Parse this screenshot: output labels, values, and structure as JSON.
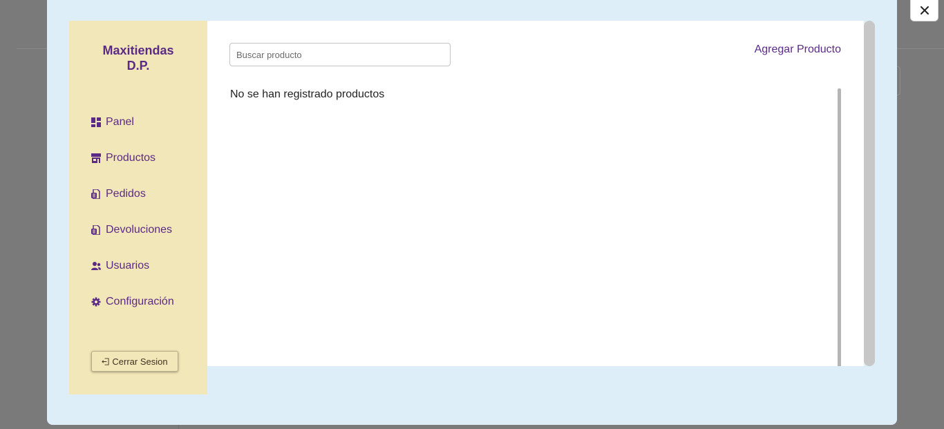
{
  "sidebar": {
    "brand_line1": "Maxitiendas",
    "brand_line2": "D.P.",
    "items": [
      {
        "label": "Panel",
        "icon": "dashboard-icon"
      },
      {
        "label": "Productos",
        "icon": "store-icon"
      },
      {
        "label": "Pedidos",
        "icon": "file-invoice-icon"
      },
      {
        "label": "Devoluciones",
        "icon": "file-invoice-icon"
      },
      {
        "label": "Usuarios",
        "icon": "users-icon"
      },
      {
        "label": "Configuración",
        "icon": "gear-icon"
      }
    ],
    "logout_label": "Cerrar Sesion"
  },
  "main": {
    "search_placeholder": "Buscar producto",
    "add_label": "Agregar Producto",
    "empty_message": "No se han registrado productos"
  },
  "colors": {
    "accent": "#5b2a86",
    "sidebar_bg": "#f2e7b8",
    "modal_bg": "#deeef8"
  }
}
